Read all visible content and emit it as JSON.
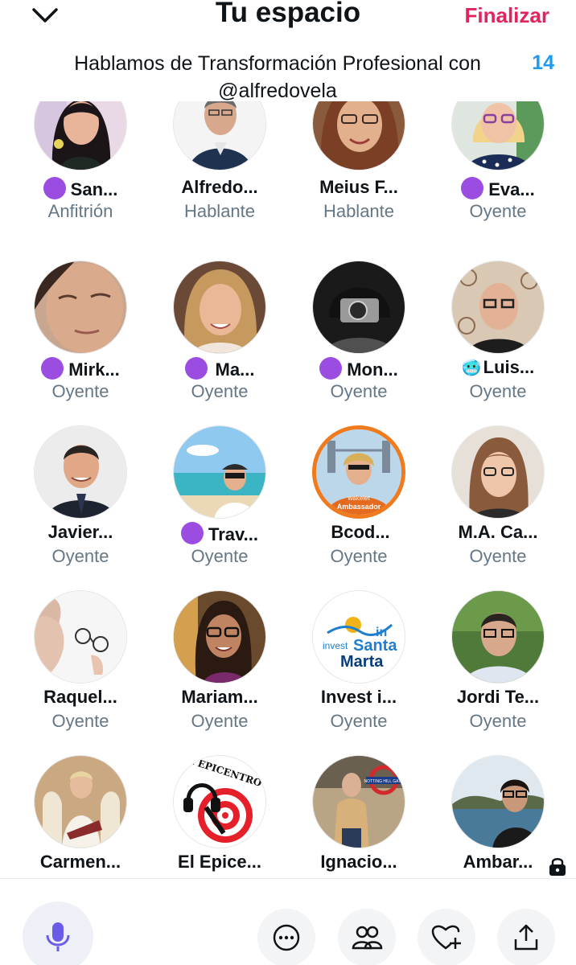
{
  "header": {
    "title": "Tu espacio",
    "finish_label": "Finalizar",
    "space_title": "Hablamos de Transformación Profesional con @alfredovela",
    "listener_count": "14"
  },
  "participants": [
    {
      "name": "San...",
      "role": "Anfitrión"
    },
    {
      "name": "Alfredo...",
      "role": "Hablante"
    },
    {
      "name": "Meius F...",
      "role": "Hablante"
    },
    {
      "name": "Eva...",
      "role": "Oyente"
    },
    {
      "name": "Mirk...",
      "role": "Oyente"
    },
    {
      "name": "Ma...",
      "role": "Oyente"
    },
    {
      "name": "Mon...",
      "role": "Oyente"
    },
    {
      "name": "Luis...",
      "role": "Oyente"
    },
    {
      "name": "Javier...",
      "role": "Oyente"
    },
    {
      "name": "Trav...",
      "role": "Oyente"
    },
    {
      "name": "Bcod...",
      "role": "Oyente"
    },
    {
      "name": "M.A. Ca...",
      "role": "Oyente"
    },
    {
      "name": "Raquel...",
      "role": "Oyente"
    },
    {
      "name": "Mariam...",
      "role": "Oyente"
    },
    {
      "name": "Invest i...",
      "role": "Oyente"
    },
    {
      "name": "Jordi Te...",
      "role": "Oyente"
    },
    {
      "name": "Carmen...",
      "role": ""
    },
    {
      "name": "El Epice...",
      "role": ""
    },
    {
      "name": "Ignacio...",
      "role": ""
    },
    {
      "name": "Ambar...",
      "role": ""
    }
  ],
  "avatar_text": {
    "wakelet_line1": "wakelet",
    "wakelet_line2": "Ambassador",
    "invest_in": "in",
    "invest_word": "invest",
    "invest_santa": "Santa",
    "invest_marta": "Marta",
    "epicentro": "EL EPICENTRO",
    "notting_hill": "NOTTING HILL GATE"
  },
  "icons": {
    "collapse": "chevron-down-icon",
    "mic": "microphone-icon",
    "more": "more-icon",
    "people": "people-icon",
    "heart": "heart-plus-icon",
    "share": "share-icon",
    "lock": "lock-icon"
  },
  "colors": {
    "accent_red": "#e0245e",
    "accent_blue": "#1d9bf0",
    "purple_badge": "#9a4de0",
    "mic_purple": "#6b5ce7"
  }
}
